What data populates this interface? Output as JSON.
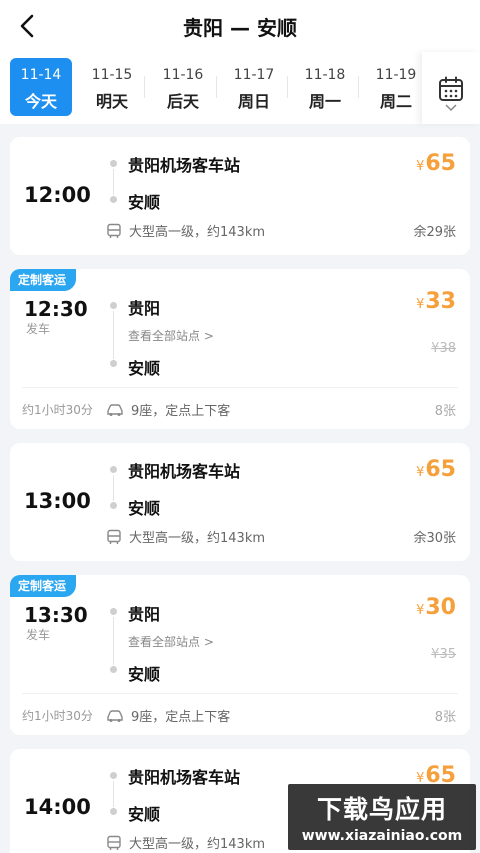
{
  "header": {
    "title": "贵阳 — 安顺"
  },
  "dates": [
    {
      "date": "11-14",
      "weekday": "今天",
      "active": true
    },
    {
      "date": "11-15",
      "weekday": "明天"
    },
    {
      "date": "11-16",
      "weekday": "后天"
    },
    {
      "date": "11-17",
      "weekday": "周日"
    },
    {
      "date": "11-18",
      "weekday": "周一"
    },
    {
      "date": "11-19",
      "weekday": "周二"
    }
  ],
  "trips": [
    {
      "time": "12:00",
      "from": "贵阳机场客车站",
      "to": "安顺",
      "currency": "¥",
      "price": "65",
      "info": "大型高一级，约143km",
      "seats": "余29张"
    },
    {
      "tag": "定制客运",
      "time": "12:30",
      "depart_label": "发车",
      "from": "贵阳",
      "all_stops": "查看全部站点 >",
      "to": "安顺",
      "currency": "¥",
      "price": "33",
      "orig": "¥38",
      "duration": "约1小时30分",
      "info": "9座，定点上下客",
      "seats": "8张"
    },
    {
      "time": "13:00",
      "from": "贵阳机场客车站",
      "to": "安顺",
      "currency": "¥",
      "price": "65",
      "info": "大型高一级，约143km",
      "seats": "余30张"
    },
    {
      "tag": "定制客运",
      "time": "13:30",
      "depart_label": "发车",
      "from": "贵阳",
      "all_stops": "查看全部站点 >",
      "to": "安顺",
      "currency": "¥",
      "price": "30",
      "orig": "¥35",
      "duration": "约1小时30分",
      "info": "9座，定点上下客",
      "seats": "8张"
    },
    {
      "time": "14:00",
      "from": "贵阳机场客车站",
      "to": "安顺",
      "currency": "¥",
      "price": "65",
      "info": "大型高一级，约143km",
      "seats": ""
    }
  ],
  "watermark": {
    "line1": "下载鸟应用",
    "line2": "www.xiazainiao.com"
  },
  "colors": {
    "accent": "#1d8ff0",
    "price": "#f5a03a",
    "tag": "#2ba6f0"
  }
}
